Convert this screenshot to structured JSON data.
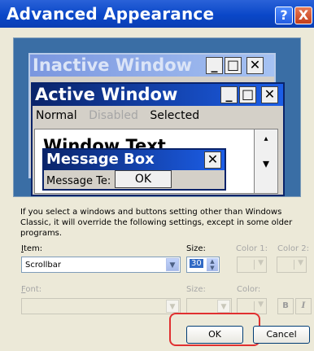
{
  "window": {
    "title": "Advanced Appearance",
    "help_glyph": "?",
    "close_glyph": "X"
  },
  "preview": {
    "inactive_title": "Inactive Window",
    "active_title": "Active Window",
    "min_glyph": "_",
    "max_glyph": "□",
    "close_glyph": "✕",
    "menu": {
      "normal": "Normal",
      "disabled": "Disabled",
      "selected": "Selected"
    },
    "window_text": "Window Text",
    "message_box": {
      "title": "Message Box",
      "text": "Message Te:",
      "ok": "OK"
    }
  },
  "info_text": "If you select a windows and buttons setting other than Windows Classic, it will override the following settings, except in some older programs.",
  "item": {
    "label_prefix": "I",
    "label_rest": "tem:",
    "value": "Scrollbar"
  },
  "size1": {
    "label": "Size:",
    "value": "30"
  },
  "color1": {
    "label": "Color 1:"
  },
  "color2": {
    "label": "Color 2:"
  },
  "font": {
    "label_prefix": "F",
    "label_rest": "ont:"
  },
  "size2": {
    "label": "Size:"
  },
  "color3": {
    "label": "Color:"
  },
  "bold_glyph": "B",
  "italic_glyph": "I",
  "buttons": {
    "ok": "OK",
    "cancel": "Cancel"
  },
  "colors": {
    "titlebar": "#0a47c8",
    "desktop": "#3a6ea5",
    "highlight_ring": "#e03030"
  }
}
